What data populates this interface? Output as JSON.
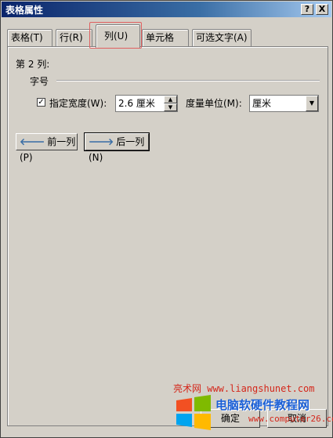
{
  "window": {
    "title": "表格属性",
    "help_btn": "?",
    "close_btn": "X"
  },
  "tabs": [
    {
      "label": "表格(T)"
    },
    {
      "label": "行(R)"
    },
    {
      "label": "列(U)"
    },
    {
      "label": "单元格(E)"
    },
    {
      "label": "可选文字(A)"
    }
  ],
  "panel": {
    "section_title": "第 2 列:",
    "group_label": "字号",
    "checkbox_label": "指定宽度(W):",
    "checkbox_checked": "✓",
    "width_value": "2.6 厘米",
    "unit_label": "度量单位(M):",
    "unit_value": "厘米",
    "prev_btn": "前一列(P)",
    "next_btn": "后一列(N)"
  },
  "footer": {
    "ok": "确定",
    "cancel": "取消"
  },
  "watermark": {
    "site": "亮术网 www.liangshunet.com",
    "brand": "电脑软硬件教程网",
    "url": "www.computer26.com"
  },
  "colors": {
    "accent": "#0a246a",
    "highlight": "#e06060",
    "watermark_red": "#d4271b",
    "watermark_blue": "#1a5fd6"
  }
}
